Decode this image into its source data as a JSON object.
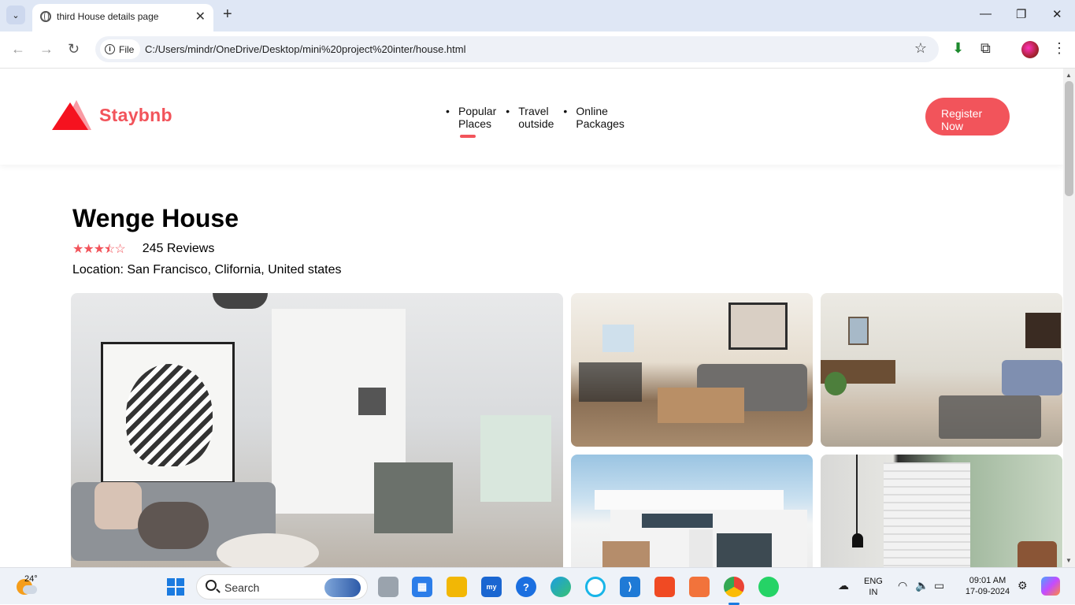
{
  "browser": {
    "tab_title": "third House details page",
    "site_chip": "File",
    "url": "C:/Users/mindr/OneDrive/Desktop/mini%20project%20inter/house.html"
  },
  "site": {
    "logo_text": "Staybnb",
    "nav": [
      {
        "line1": "Popular",
        "line2": "Places"
      },
      {
        "line1": "Travel",
        "line2": "outside"
      },
      {
        "line1": "Online",
        "line2": "Packages"
      }
    ],
    "register": {
      "line1": "Register",
      "line2": "Now"
    },
    "accent_color": "#f2545b"
  },
  "house": {
    "title": "Wenge House",
    "rating": 3.5,
    "rating_max": 5,
    "reviews": "245 Reviews",
    "location": "Location: San Francisco, Clifornia, United states"
  },
  "taskbar": {
    "temperature": "24°",
    "search_label": "Search",
    "lang_line1": "ENG",
    "lang_line2": "IN",
    "time": "09:01 AM",
    "date": "17-09-2024"
  }
}
